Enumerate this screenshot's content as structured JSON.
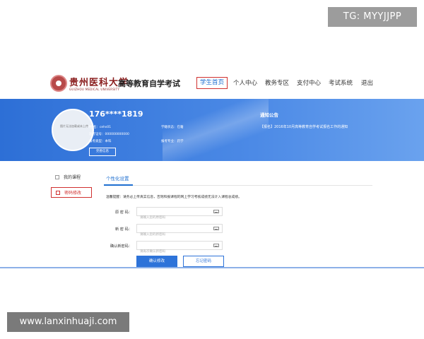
{
  "overlays": {
    "top_right": "TG: MYYJJPP",
    "bottom_left": "www.lanxinhuaji.com"
  },
  "header": {
    "university_name": "贵州医科大学",
    "university_en": "GUIZHOU MEDICAL UNIVERSITY",
    "system_title": "高等教育自学考试",
    "nav": [
      {
        "label": "学生首页",
        "active": true
      },
      {
        "label": "个人中心"
      },
      {
        "label": "教务专区"
      },
      {
        "label": "支付中心"
      },
      {
        "label": "考试系统"
      },
      {
        "label": "退出"
      }
    ]
  },
  "profile": {
    "avatar_text": "图片无法加载或未上传",
    "phone": "176****1819",
    "name_label": "姓    名：",
    "name_value": "cehs01",
    "status_label": "学籍状态：",
    "status_value": "在籍",
    "permit_label": "准考证号：",
    "permit_value": "000000000000",
    "level_label": "报考类型：",
    "level_value": "本科",
    "major_label": "报考专业：",
    "major_value": "药学",
    "edit_button": "完善信息"
  },
  "notice": {
    "title": "通知公告",
    "item": "【报名】2016年10月高等教育自学考试报名工作的通知"
  },
  "sidebar": [
    {
      "label": "我的课程"
    },
    {
      "label": "密码修改",
      "active": true
    }
  ],
  "form": {
    "tab": "个性化设置",
    "tip": "温馨提醒：请务必上传真实信息，否则和报课程的网上学习考核成绩无法计入课程总成绩。",
    "fields": [
      {
        "label": "原 密 码：",
        "placeholder": "请输入您的原密码"
      },
      {
        "label": "新 密 码：",
        "placeholder": "请输入您的新密码"
      },
      {
        "label": "确认新密码：",
        "placeholder": "请再次确认新密码"
      }
    ],
    "confirm_button": "确认修改",
    "forgot_button": "忘记密码"
  },
  "colors": {
    "accent": "#2d73d9",
    "highlight": "#d0302f",
    "brand": "#8a1e1e"
  },
  "icons": [
    "keyboard-icon",
    "book-icon",
    "edit-icon"
  ]
}
